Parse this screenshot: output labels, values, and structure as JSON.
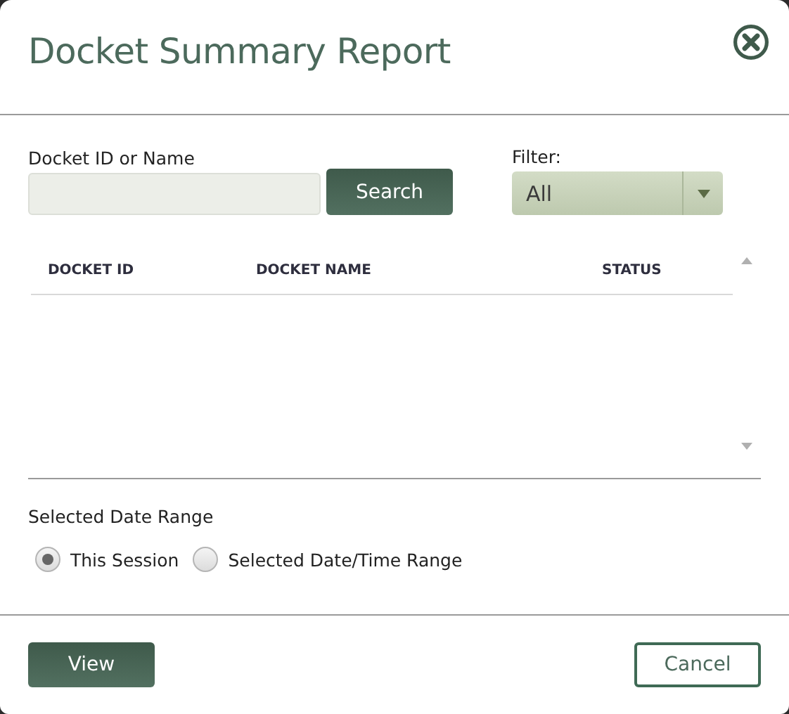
{
  "dialog": {
    "title": "Docket Summary Report"
  },
  "search": {
    "label": "Docket ID or Name",
    "button": "Search"
  },
  "filter": {
    "label": "Filter:",
    "value": "All"
  },
  "table": {
    "columns": [
      "DOCKET ID",
      "DOCKET NAME",
      "STATUS"
    ]
  },
  "date_range": {
    "label": "Selected Date Range",
    "options": [
      {
        "label": "This Session",
        "selected": true
      },
      {
        "label": "Selected Date/Time Range",
        "selected": false
      }
    ]
  },
  "buttons": [
    {
      "label": "View",
      "kind": "primary"
    },
    {
      "label": "Cancel",
      "kind": "secondary"
    }
  ]
}
